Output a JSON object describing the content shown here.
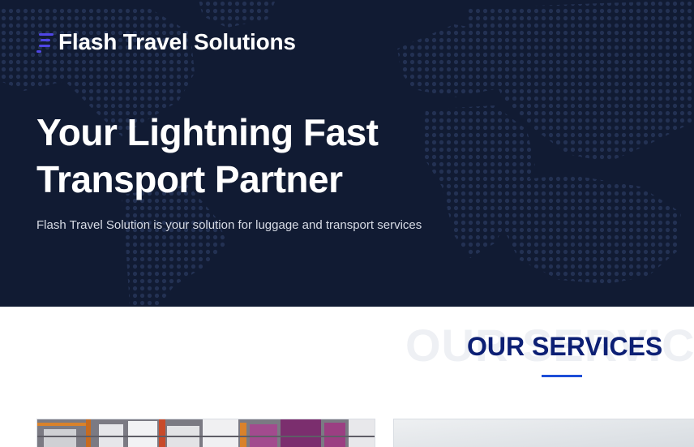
{
  "brand": {
    "name": "Flash Travel Solutions",
    "accent_color": "#4f46e5",
    "logo_icon": "speed-lines-icon"
  },
  "hero": {
    "headline_line1": "Your Lightning Fast",
    "headline_line2": "Transport Partner",
    "subtitle": "Flash Travel Solution is your solution for luggage and transport services",
    "background_color": "#111b33",
    "background_graphic": "dotted-world-map"
  },
  "services": {
    "title": "OUR SERVICES",
    "background_text": "OUR SERVICES",
    "title_color": "#0c1f74",
    "underline_color": "#1d4ed8",
    "cards": [
      {
        "image": "warehouse-shelves-photo"
      },
      {
        "image": "sky-photo"
      }
    ]
  }
}
